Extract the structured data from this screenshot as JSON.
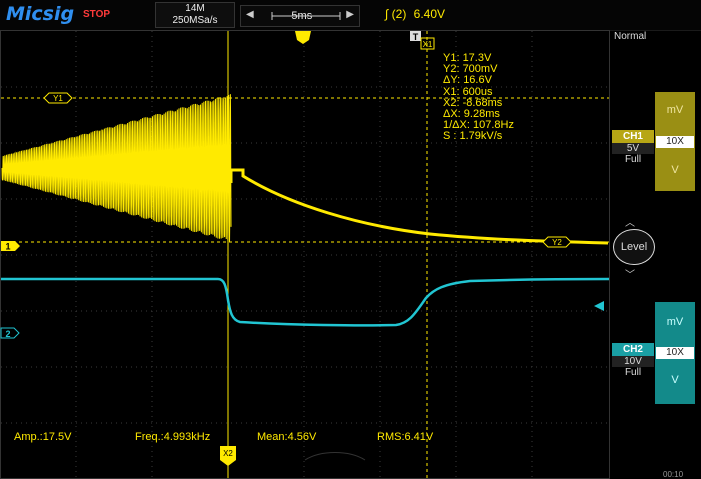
{
  "header": {
    "brand": "Micsig",
    "run_state": "STOP",
    "memory_depth": "14M",
    "sample_rate": "250MSa/s",
    "time_offset": "-5ms",
    "trigger_channel_num": "2",
    "trigger_level": "6.40V"
  },
  "trigger_mode": "Normal",
  "cursor_readout": {
    "y1": "Y1:  17.3V",
    "y2": "Y2:  700mV",
    "dy": "ΔY:  16.6V",
    "x1": "X1:  600us",
    "x2": "X2:  -8.68ms",
    "dx": "ΔX:  9.28ms",
    "inv_dx": "1/ΔX:  107.8Hz",
    "slope": "S :  1.79kV/s"
  },
  "marker_labels": {
    "ch1": "1",
    "ch2": "2",
    "y1": "Y1",
    "y2": "Y2",
    "x1": "X1",
    "x2": "X2",
    "trigger": "T"
  },
  "measurements": {
    "amp": "Amp.:17.5V",
    "freq": "Freq.:4.993kHz",
    "mean": "Mean:4.56V",
    "rms": "RMS:6.41V"
  },
  "channel1": {
    "label": "CH1",
    "scale": "5V",
    "bandwidth": "Full",
    "unit": "mV",
    "probe": "10X",
    "unit2": "V",
    "color": "#ffea00"
  },
  "channel2": {
    "label": "CH2",
    "scale": "10V",
    "bandwidth": "Full",
    "unit": "mV",
    "probe": "10X",
    "unit2": "V",
    "color": "#21c5d2"
  },
  "level_label": "Level",
  "clock_partial": "00:10"
}
